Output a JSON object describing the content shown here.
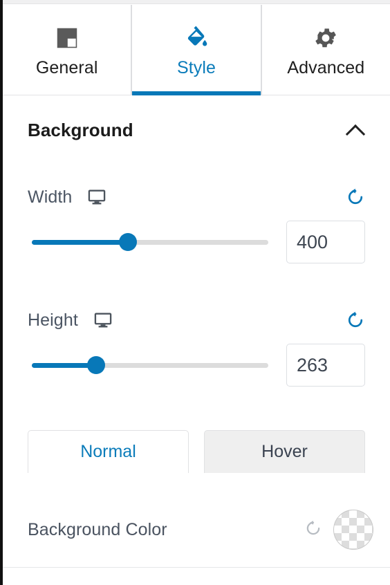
{
  "panel": {
    "accent_color": "#0878b8",
    "text_color": "#4b5563"
  },
  "tabs": [
    {
      "label": "General",
      "icon": "layout-square-icon",
      "active": false
    },
    {
      "label": "Style",
      "icon": "paint-bucket-icon",
      "active": true
    },
    {
      "label": "Advanced",
      "icon": "gear-icon",
      "active": false
    }
  ],
  "section": {
    "title": "Background",
    "collapse_icon": "chevron-up-icon",
    "expanded": true
  },
  "controls": [
    {
      "key": "width",
      "label": "Width",
      "device_icon": "desktop-icon",
      "reset_icon": "reset-icon",
      "value": "400",
      "slider_percent": 41
    },
    {
      "key": "height",
      "label": "Height",
      "device_icon": "desktop-icon",
      "reset_icon": "reset-icon",
      "value": "263",
      "slider_percent": 28
    }
  ],
  "state_tabs": [
    {
      "label": "Normal",
      "active": true
    },
    {
      "label": "Hover",
      "active": false
    }
  ],
  "background_color": {
    "label": "Background Color",
    "reset_icon": "reset-icon",
    "swatch": "transparent-checkerboard-swatch",
    "value": "transparent"
  }
}
